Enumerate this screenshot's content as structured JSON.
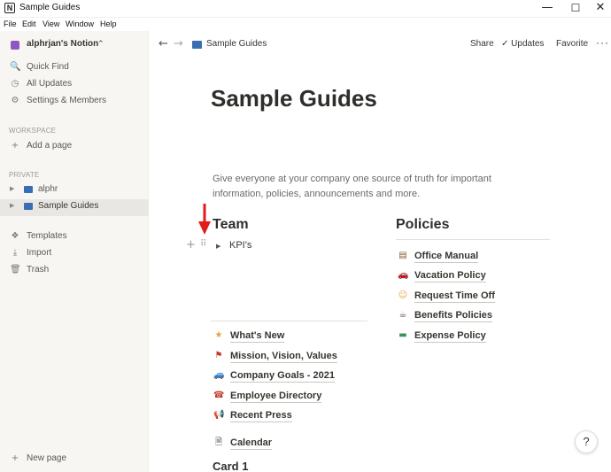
{
  "window": {
    "title": "Sample Guides",
    "app_icon": "N",
    "minimize_icon": "—",
    "maximize_icon": "☐",
    "close_icon": "✕"
  },
  "menu": [
    "File",
    "Edit",
    "View",
    "Window",
    "Help"
  ],
  "sidebar": {
    "workspace_name": "alphrjan's Notion",
    "workspace_chevron": "⌃⌄",
    "top_items": [
      {
        "icon": "search-icon",
        "glyph": "🔍",
        "label": "Quick Find"
      },
      {
        "icon": "clock-icon",
        "glyph": "◷",
        "label": "All Updates"
      },
      {
        "icon": "gear-icon",
        "glyph": "⚙",
        "label": "Settings & Members"
      }
    ],
    "workspace_section": "WORKSPACE",
    "add_page_label": "Add a page",
    "private_section": "PRIVATE",
    "pages": [
      {
        "label": "alphr",
        "active": false
      },
      {
        "label": "Sample Guides",
        "active": true
      }
    ],
    "bottom_items": [
      {
        "icon": "templates-icon",
        "glyph": "❖",
        "label": "Templates"
      },
      {
        "icon": "import-icon",
        "glyph": "⤓",
        "label": "Import"
      },
      {
        "icon": "trash-icon",
        "glyph": "🗑",
        "label": "Trash"
      }
    ],
    "new_page_label": "New page"
  },
  "topbar": {
    "back_icon": "←",
    "forward_icon": "→",
    "breadcrumb": "Sample Guides",
    "share_label": "Share",
    "updates_label": "Updates",
    "favorite_label": "Favorite",
    "more_icon": "···"
  },
  "page": {
    "title": "Sample Guides",
    "description": "Give everyone at your company one source of truth for important information, policies, announcements and more.",
    "team": {
      "heading": "Team",
      "toggle_label": "KPI's",
      "links": [
        {
          "emoji": "★",
          "color": "#e8a33d",
          "label": "What's New"
        },
        {
          "emoji": "⚑",
          "color": "#c0392b",
          "label": "Mission, Vision, Values"
        },
        {
          "emoji": "🚙",
          "color": "#2e6fb7",
          "label": "Company Goals - 2021"
        },
        {
          "emoji": "☎",
          "color": "#c0392b",
          "label": "Employee Directory"
        },
        {
          "emoji": "📢",
          "color": "#2e6fb7",
          "label": "Recent Press"
        }
      ],
      "calendar_label": "Calendar",
      "card_heading": "Card 1"
    },
    "policies": {
      "heading": "Policies",
      "links": [
        {
          "emoji": "▤",
          "color": "#8b5a2b",
          "label": "Office Manual"
        },
        {
          "emoji": "🚗",
          "color": "#c0392b",
          "label": "Vacation Policy"
        },
        {
          "emoji": "☺",
          "color": "#e8a33d",
          "label": "Request Time Off"
        },
        {
          "emoji": "☕",
          "color": "#6b4a3a",
          "label": "Benefits Policies"
        },
        {
          "emoji": "▬",
          "color": "#3f8f4f",
          "label": "Expense Policy"
        }
      ]
    }
  },
  "help_label": "?"
}
